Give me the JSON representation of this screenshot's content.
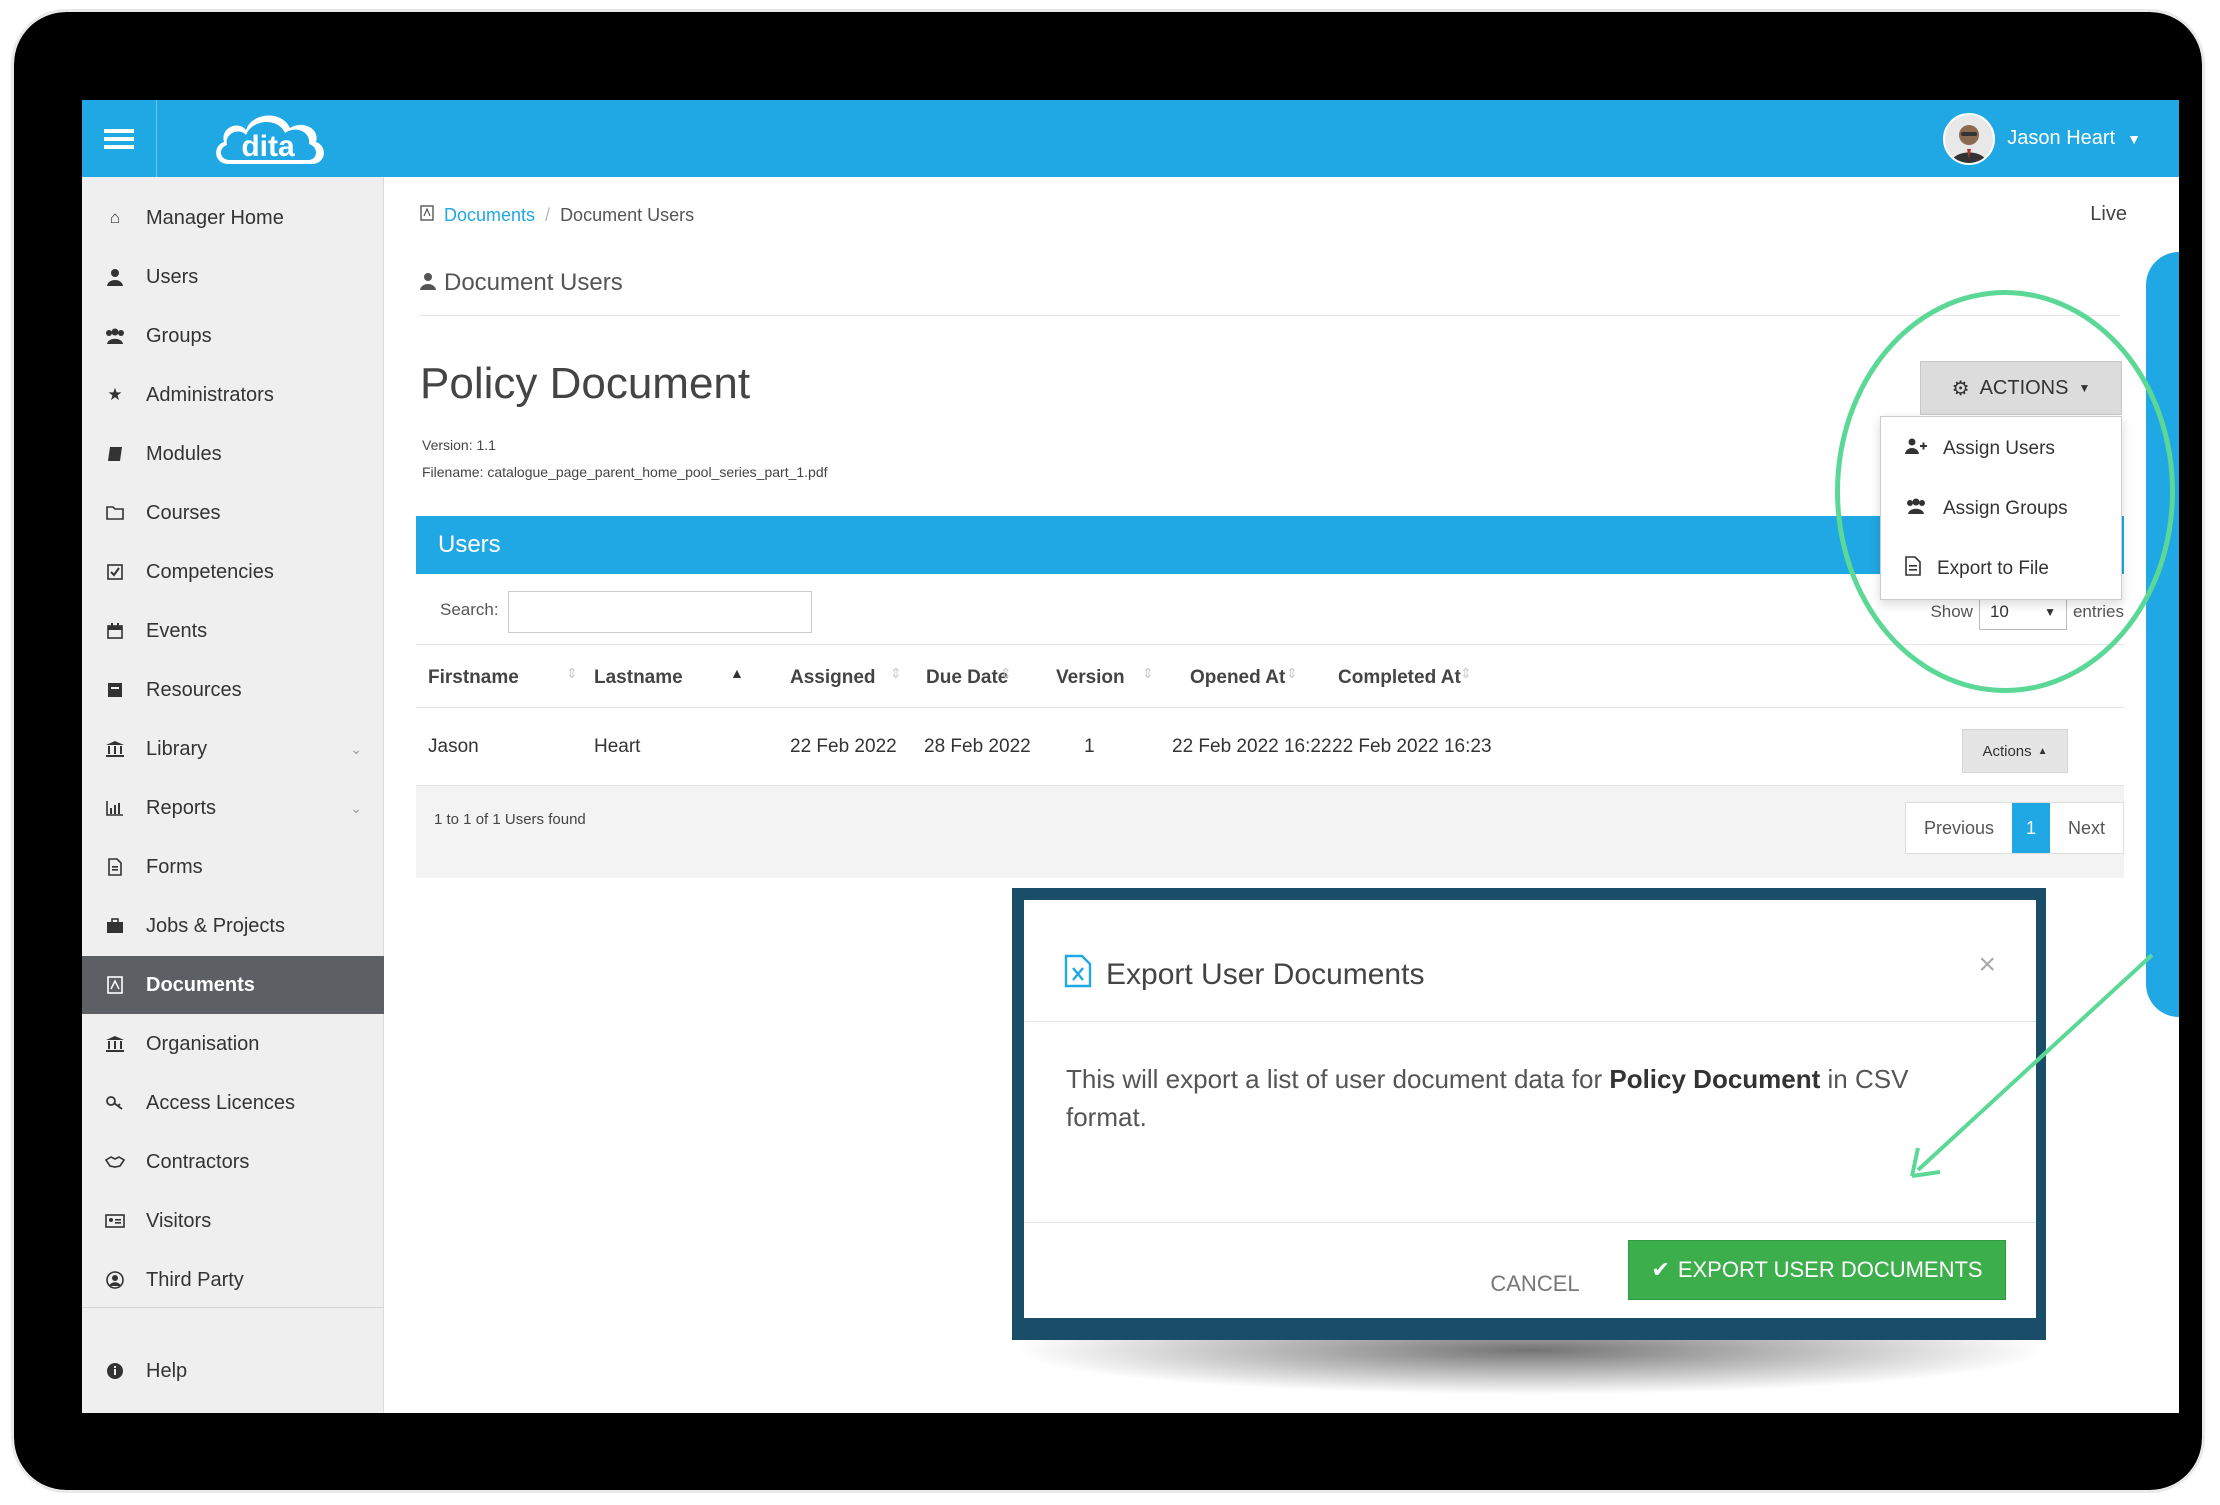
{
  "app": {
    "logo_text": "dita",
    "user_name": "Jason Heart"
  },
  "sidebar": {
    "items": [
      {
        "label": "Manager Home",
        "icon": "home-icon"
      },
      {
        "label": "Users",
        "icon": "user-icon"
      },
      {
        "label": "Groups",
        "icon": "users-icon"
      },
      {
        "label": "Administrators",
        "icon": "star-icon"
      },
      {
        "label": "Modules",
        "icon": "book-icon"
      },
      {
        "label": "Courses",
        "icon": "folder-icon"
      },
      {
        "label": "Competencies",
        "icon": "check-square-icon"
      },
      {
        "label": "Events",
        "icon": "calendar-icon"
      },
      {
        "label": "Resources",
        "icon": "archive-icon"
      },
      {
        "label": "Library",
        "icon": "bank-icon"
      },
      {
        "label": "Reports",
        "icon": "bar-chart-icon"
      },
      {
        "label": "Forms",
        "icon": "file-text-icon"
      },
      {
        "label": "Jobs & Projects",
        "icon": "briefcase-icon"
      },
      {
        "label": "Documents",
        "icon": "file-pdf-icon"
      },
      {
        "label": "Organisation",
        "icon": "bank-icon"
      },
      {
        "label": "Access Licences",
        "icon": "key-icon"
      },
      {
        "label": "Contractors",
        "icon": "handshake-icon"
      },
      {
        "label": "Visitors",
        "icon": "id-card-icon"
      },
      {
        "label": "Third Party",
        "icon": "user-circle-icon"
      }
    ],
    "help": "Help"
  },
  "breadcrumb": {
    "link": "Documents",
    "current": "Document Users"
  },
  "status": "Live",
  "section_heading": "Document Users",
  "document": {
    "title": "Policy Document",
    "version": "Version: 1.1",
    "filename": "Filename: catalogue_page_parent_home_pool_series_part_1.pdf"
  },
  "actions": {
    "label": "ACTIONS",
    "menu": [
      "Assign Users",
      "Assign Groups",
      "Export to File"
    ]
  },
  "users_panel": {
    "title": "Users",
    "search_label": "Search:",
    "search_value": "",
    "show_label": "Show",
    "show_value": "10",
    "entries_label": "entries",
    "columns": [
      "Firstname",
      "Lastname",
      "Assigned",
      "Due Date",
      "Version",
      "Opened At",
      "Completed At"
    ],
    "rows": [
      {
        "firstname": "Jason",
        "lastname": "Heart",
        "assigned": "22 Feb 2022",
        "due_date": "28 Feb 2022",
        "version": "1",
        "opened_at": "22 Feb 2022 16:22",
        "completed_at": "22 Feb 2022 16:23",
        "action": "Actions"
      }
    ],
    "found_text": "1 to 1 of 1 Users found",
    "pager": {
      "previous": "Previous",
      "current": "1",
      "next": "Next"
    }
  },
  "modal": {
    "title": "Export User Documents",
    "close": "×",
    "body_prefix": "This will export a list of user document data for ",
    "body_bold": "Policy Document",
    "body_suffix": " in CSV format.",
    "cancel": "CANCEL",
    "confirm": "EXPORT USER DOCUMENTS"
  },
  "colors": {
    "brand_blue": "#1fa8e3",
    "success_green": "#3cae4c",
    "annotation_green": "#5bd896",
    "active_nav": "#5c6064"
  }
}
